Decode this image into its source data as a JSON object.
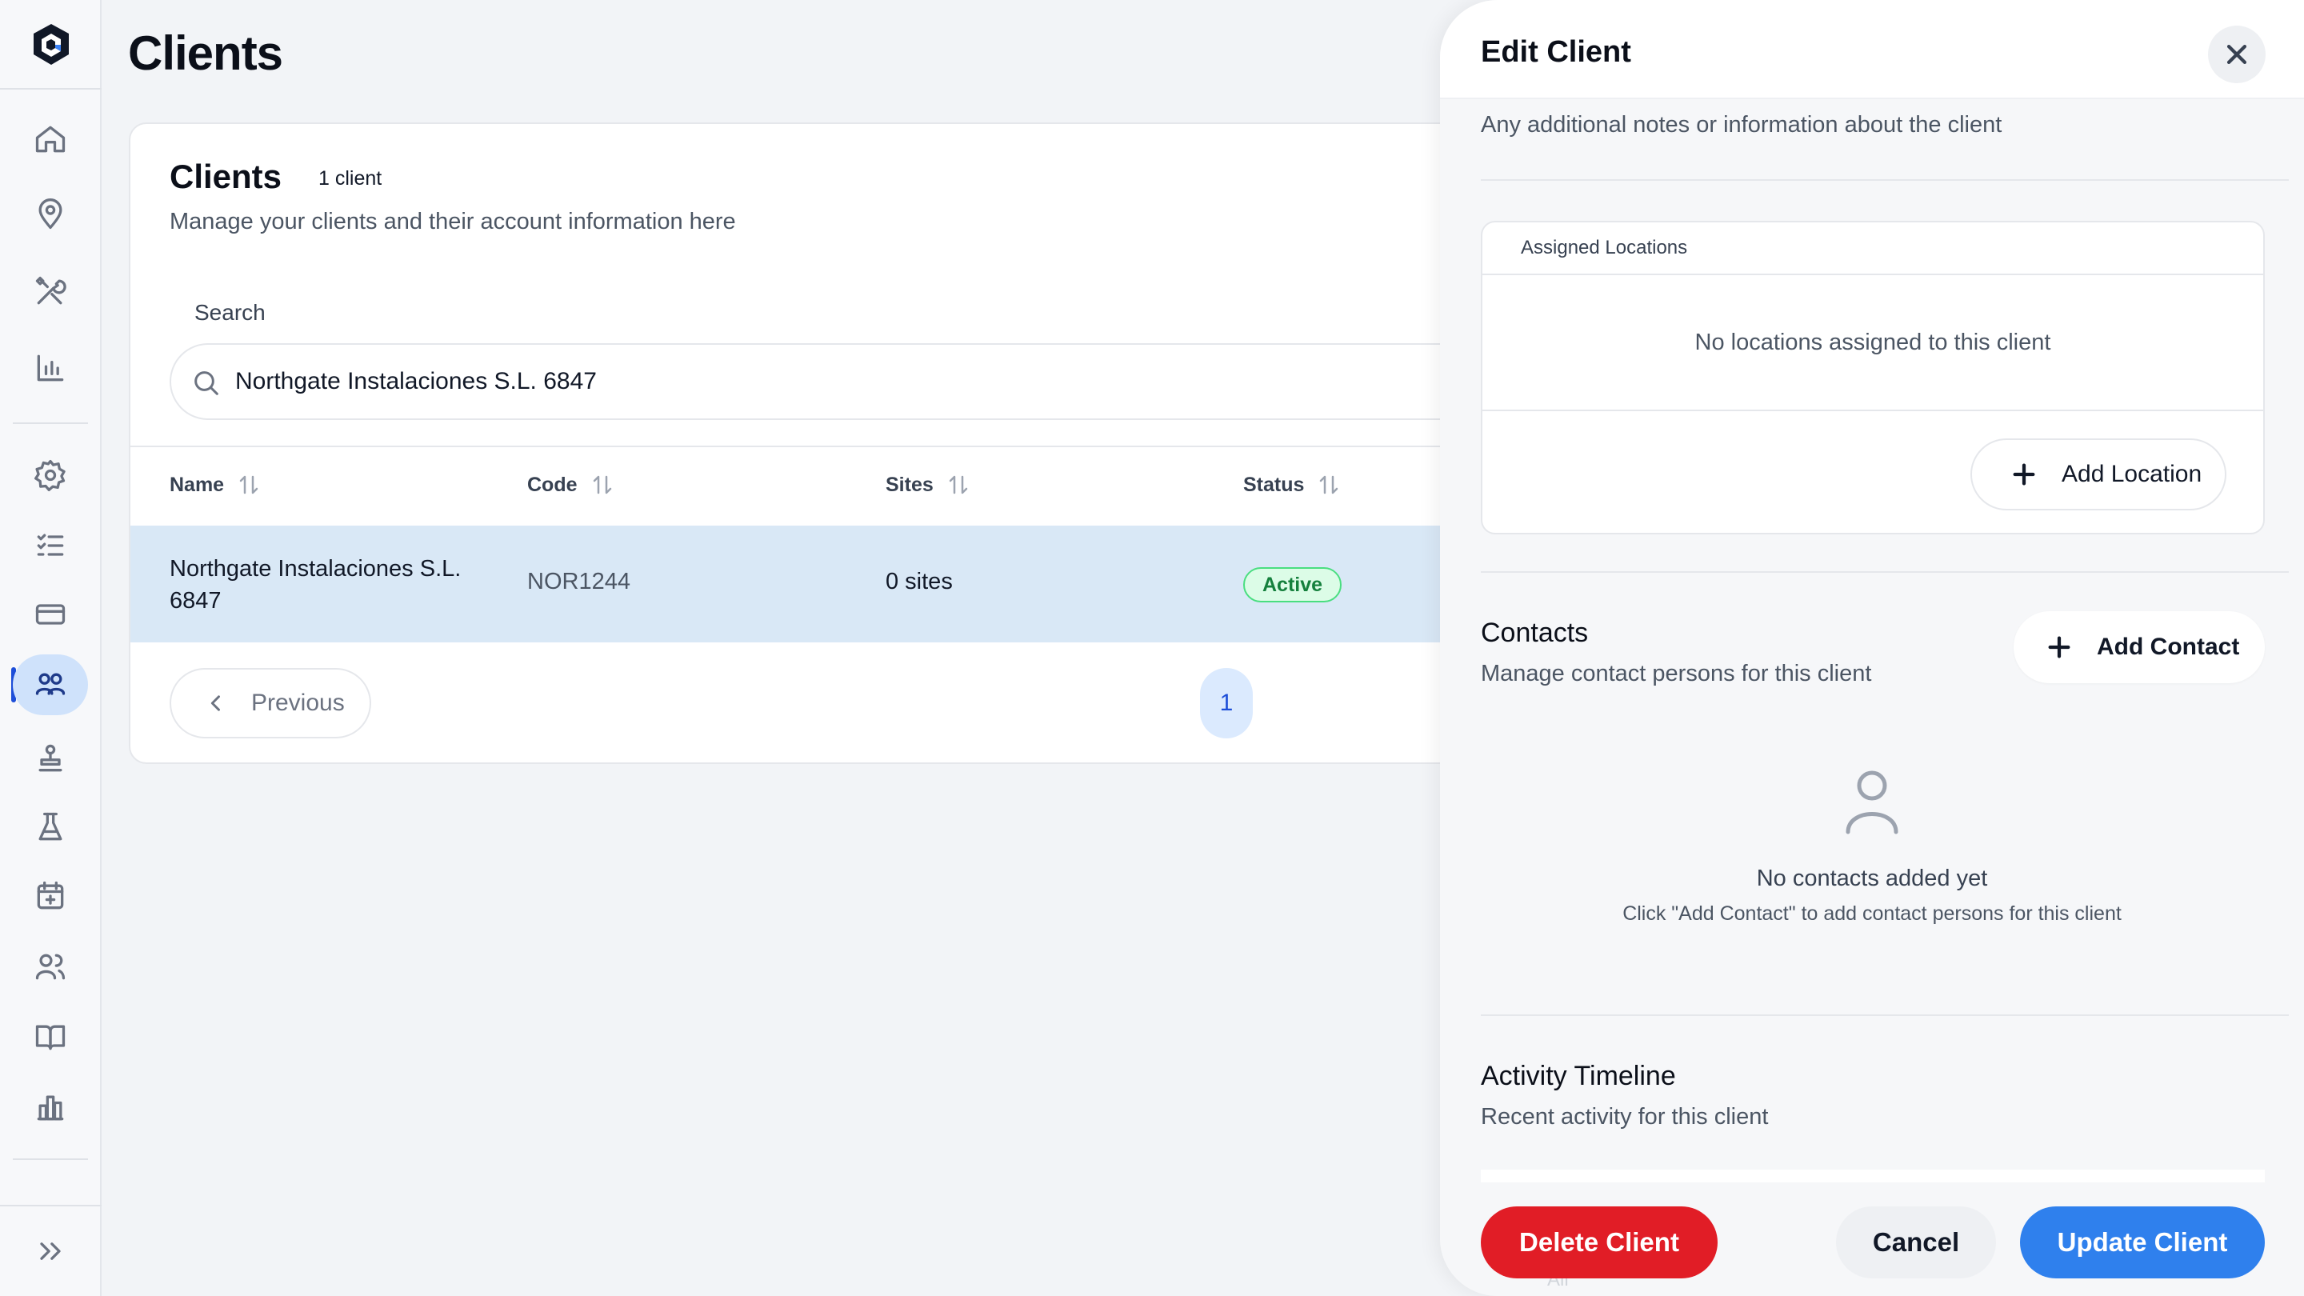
{
  "page": {
    "title": "Clients"
  },
  "sidebar": {
    "items": [
      {
        "icon": "home-icon"
      },
      {
        "icon": "location-pin-icon"
      },
      {
        "icon": "tools-icon"
      },
      {
        "icon": "bar-chart-icon"
      },
      {
        "icon": "gear-icon"
      },
      {
        "icon": "checklist-icon"
      },
      {
        "icon": "credit-card-icon"
      },
      {
        "icon": "clients-icon",
        "active": true
      },
      {
        "icon": "stamp-icon"
      },
      {
        "icon": "flask-icon"
      },
      {
        "icon": "calendar-plus-icon"
      },
      {
        "icon": "users-icon"
      },
      {
        "icon": "book-icon"
      },
      {
        "icon": "buildings-chart-icon"
      },
      {
        "icon": "expand-icon"
      }
    ],
    "active_color": "#cfe2fb"
  },
  "clients_card": {
    "title": "Clients",
    "count_badge": "1 client",
    "subtitle": "Manage your clients and their account information here",
    "search": {
      "label": "Search",
      "value": "Northgate Instalaciones S.L. 6847",
      "placeholder": ""
    },
    "columns": [
      "Name",
      "Code",
      "Sites",
      "Status"
    ],
    "rows": [
      {
        "name": "Northgate Instalaciones S.L. 6847",
        "code": "NOR1244",
        "sites": "0 sites",
        "status": "Active"
      }
    ],
    "pagination": {
      "previous": "Previous",
      "current_page": "1"
    }
  },
  "edit_panel": {
    "title": "Edit Client",
    "notes_helper": "Any additional notes or information about the client",
    "locations": {
      "label": "Assigned Locations",
      "empty": "No locations assigned to this client",
      "add_button": "Add Location"
    },
    "contacts": {
      "title": "Contacts",
      "subtitle": "Manage contact persons for this client",
      "add_button": "Add Contact",
      "empty_title": "No contacts added yet",
      "empty_hint": "Click \"Add Contact\" to add contact persons for this client"
    },
    "activity": {
      "title": "Activity Timeline",
      "subtitle": "Recent activity for this client",
      "peek_text": "All"
    },
    "footer": {
      "delete": "Delete Client",
      "cancel": "Cancel",
      "update": "Update Client"
    }
  },
  "colors": {
    "accent": "#2f80ed",
    "danger": "#e11d26",
    "active_badge": "#15803d",
    "selected_row": "#d9e8f6"
  }
}
